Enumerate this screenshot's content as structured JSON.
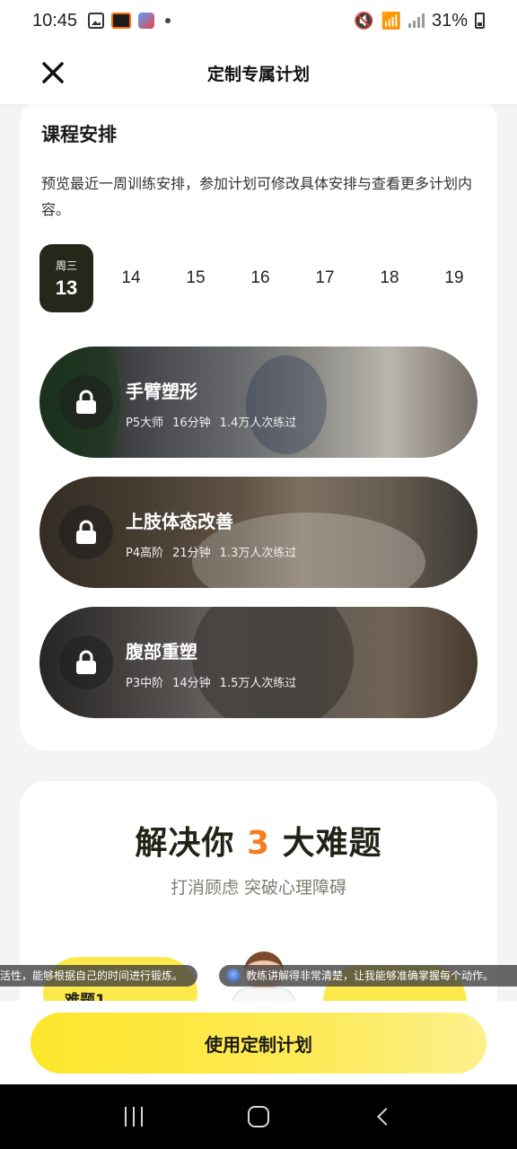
{
  "status_bar": {
    "time": "10:45",
    "battery": "31%"
  },
  "header": {
    "title": "定制专属计划",
    "close_icon": "close-x"
  },
  "schedule": {
    "title": "课程安排",
    "description": "预览最近一周训练安排，参加计划可修改具体安排与查看更多计划内容。",
    "days": [
      {
        "weekday": "周三",
        "num": "13",
        "active": true
      },
      {
        "num": "14"
      },
      {
        "num": "15"
      },
      {
        "num": "16"
      },
      {
        "num": "17"
      },
      {
        "num": "18"
      },
      {
        "num": "19"
      }
    ],
    "courses": [
      {
        "title": "手臂塑形",
        "level": "P5大师",
        "duration": "16分钟",
        "count": "1.4万人次练过",
        "icon": "lock-icon"
      },
      {
        "title": "上肢体态改善",
        "level": "P4高阶",
        "duration": "21分钟",
        "count": "1.3万人次练过",
        "icon": "lock-icon"
      },
      {
        "title": "腹部重塑",
        "level": "P3中阶",
        "duration": "14分钟",
        "count": "1.5万人次练过",
        "icon": "lock-icon"
      }
    ]
  },
  "problems": {
    "title_before": "解决你 ",
    "title_accent": "3",
    "title_after": " 大难题",
    "subtitle": "打消顾虑 突破心理障碍",
    "problem_label": "难题1",
    "accent_color": "#f57c1f"
  },
  "toasts": {
    "left": "活性，能够根据自己的时间进行锻炼。",
    "right": "教练讲解得非常清楚，让我能够准确掌握每个动作。"
  },
  "cta": {
    "label": "使用定制计划"
  }
}
